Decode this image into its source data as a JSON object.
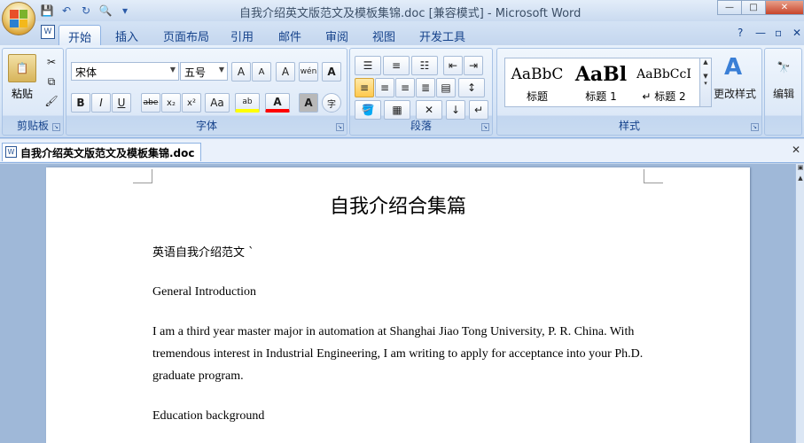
{
  "window": {
    "title": "自我介绍英文版范文及模板集锦.doc [兼容模式] - Microsoft Word",
    "controls": {
      "minimize": "—",
      "maximize": "□",
      "close": "✕"
    }
  },
  "qat": {
    "save": "💾",
    "undo": "↶",
    "redo": "↻",
    "print_preview": "🔍",
    "customize": "▾"
  },
  "tabs": [
    {
      "label": "开始",
      "active": true
    },
    {
      "label": "插入"
    },
    {
      "label": "页面布局"
    },
    {
      "label": "引用"
    },
    {
      "label": "邮件"
    },
    {
      "label": "审阅"
    },
    {
      "label": "视图"
    },
    {
      "label": "开发工具"
    }
  ],
  "tab_right": {
    "help": "?",
    "minimize": "—",
    "restore": "▫",
    "close": "✕"
  },
  "ribbon": {
    "clipboard": {
      "label": "剪贴板",
      "paste": "粘贴"
    },
    "font": {
      "label": "字体",
      "font_name": "宋体",
      "font_size": "五号",
      "grow": "A",
      "shrink": "A",
      "clear": "A",
      "phonetic": "wén",
      "border": "A",
      "bold": "B",
      "italic": "I",
      "underline": "U",
      "strike": "abe",
      "sub": "x₂",
      "sup": "x²",
      "case": "Aa",
      "highlight": "ab",
      "color": "A",
      "shade": "A",
      "enclose": "字"
    },
    "paragraph": {
      "label": "段落"
    },
    "styles": {
      "label": "样式",
      "items": [
        {
          "sample": "AaBbC",
          "name": "标题"
        },
        {
          "sample": "AaBl",
          "name": "标题 1"
        },
        {
          "sample": "AaBbCcI",
          "name": "↵ 标题 2"
        }
      ],
      "change_styles": "更改样式"
    },
    "editing": {
      "label": "编辑"
    }
  },
  "doctab": {
    "name": "自我介绍英文版范文及模板集锦.doc",
    "close": "✕"
  },
  "document": {
    "title": "自我介绍合集篇",
    "paragraphs": [
      "英语自我介绍范文 `",
      "General Introduction",
      "I am a third year master major in automation at Shanghai Jiao Tong University, P. R. China. With tremendous interest in Industrial Engineering, I am writing to apply for acceptance into your Ph.D. graduate program.",
      "Education background"
    ]
  },
  "colors": {
    "ribbon_bg": "#dce8f7",
    "accent": "#15428b",
    "page": "#ffffff",
    "doc_bg": "#9fb8d8"
  }
}
